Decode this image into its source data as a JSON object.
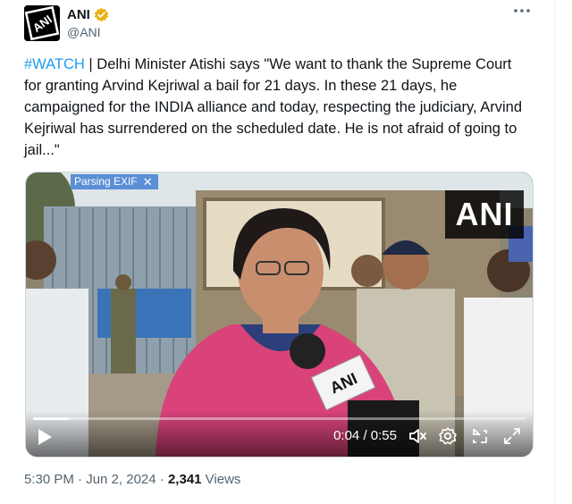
{
  "author": {
    "display_name": "ANI",
    "handle": "@ANI",
    "avatar_logo_text": "ANI",
    "verified_color": "#e8b213"
  },
  "post": {
    "hashtag": "#WATCH",
    "body": " | Delhi Minister Atishi says \"We want to thank the Supreme Court for granting Arvind Kejriwal a bail for 21 days. In these 21 days, he campaigned for the INDIA alliance and today, respecting the judiciary, Arvind Kejriwal has surrendered on the scheduled date. He is not afraid of going to jail...\""
  },
  "video": {
    "exif_badge": "Parsing EXIF",
    "exif_close": "✕",
    "watermark": "ANI",
    "mic_flag_text": "ANI",
    "current_time": "0:04",
    "duration": "0:55",
    "time_separator": " / ",
    "progress_fraction": 0.073,
    "icons": [
      "play-icon",
      "mute-icon",
      "settings-icon",
      "exit-fullscreen-icon",
      "fullscreen-icon"
    ]
  },
  "meta": {
    "time": "5:30 PM",
    "separator": " · ",
    "date": "Jun 2, 2024",
    "views_count": "2,341",
    "views_label": " Views"
  },
  "colors": {
    "link": "#1d9bf0",
    "secondary_text": "#536471",
    "saree_pink": "#d9437a"
  }
}
